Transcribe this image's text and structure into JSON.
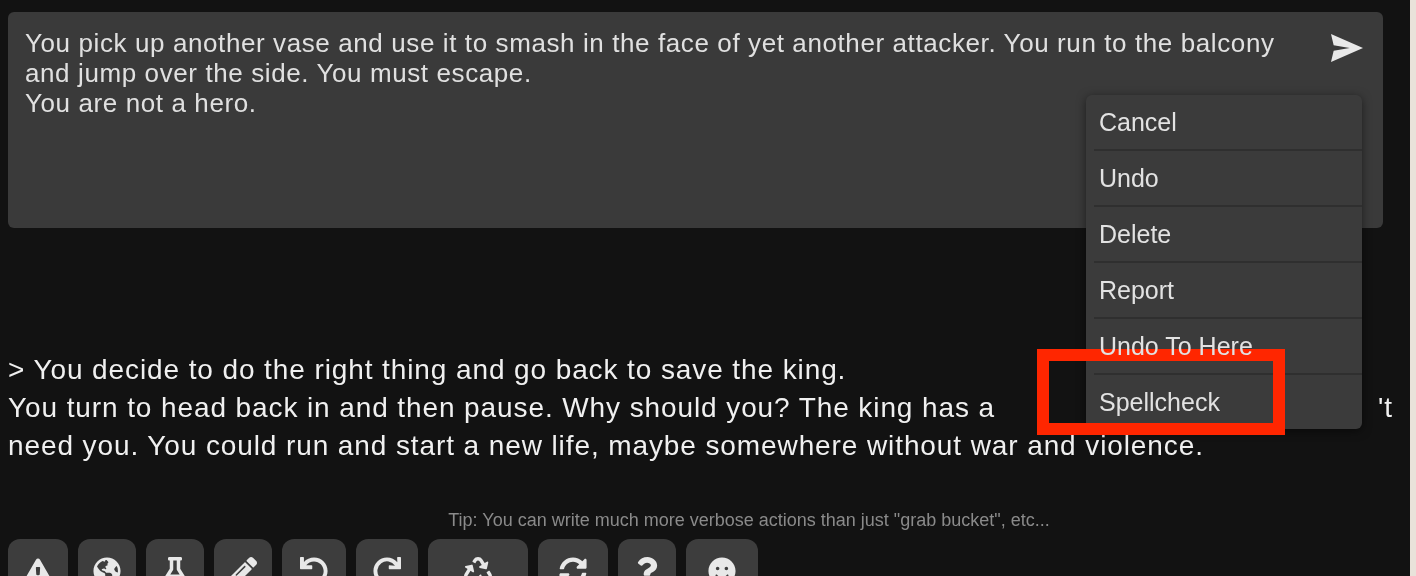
{
  "action_input": {
    "value": "You pick up another vase and use it to smash in the face of yet another attacker. You run to the balcony and jump over the side. You must escape.\nYou are not a hero."
  },
  "story": {
    "action": "> You decide to do the right thing and go back to save the king.",
    "line_start": "You turn to head back in and then pause. Why should you? The king has a",
    "line_end": "'t",
    "line_last": "need you. You could run and start a new life, maybe somewhere without war and violence."
  },
  "context_menu": [
    {
      "label": "Cancel",
      "highlighted": false
    },
    {
      "label": "Undo",
      "highlighted": false
    },
    {
      "label": "Delete",
      "highlighted": false
    },
    {
      "label": "Report",
      "highlighted": false
    },
    {
      "label": "Undo To Here",
      "highlighted": false
    },
    {
      "label": "Spellcheck",
      "highlighted": true
    }
  ],
  "tip": "Tip: You can write much more verbose actions than just \"grab bucket\", etc...",
  "toolbar": [
    {
      "kind": "warning"
    },
    {
      "kind": "globe"
    },
    {
      "kind": "flask"
    },
    {
      "kind": "pencil"
    },
    {
      "kind": "undo"
    },
    {
      "kind": "redo"
    },
    {
      "kind": "recycle"
    },
    {
      "kind": "sync"
    },
    {
      "kind": "help"
    },
    {
      "kind": "smile"
    }
  ]
}
